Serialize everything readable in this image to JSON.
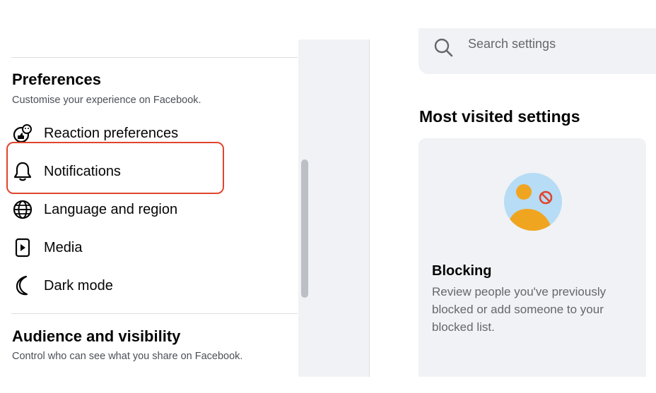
{
  "search": {
    "placeholder": "Search settings"
  },
  "preferences": {
    "title": "Preferences",
    "subtitle": "Customise your experience on Facebook.",
    "items": [
      {
        "label": "Reaction preferences",
        "icon": "reaction-icon"
      },
      {
        "label": "Notifications",
        "icon": "bell-icon"
      },
      {
        "label": "Language and region",
        "icon": "globe-icon"
      },
      {
        "label": "Media",
        "icon": "media-icon"
      },
      {
        "label": "Dark mode",
        "icon": "moon-icon"
      }
    ]
  },
  "audience": {
    "title": "Audience and visibility",
    "subtitle": "Control who can see what you share on Facebook."
  },
  "most_visited": {
    "title": "Most visited settings",
    "card": {
      "title": "Blocking",
      "description": "Review people you've previously blocked or add someone to your blocked list."
    }
  },
  "colors": {
    "highlight": "#e0452c",
    "icon_blue": "#b7dcf5",
    "icon_orange": "#f0a521"
  }
}
